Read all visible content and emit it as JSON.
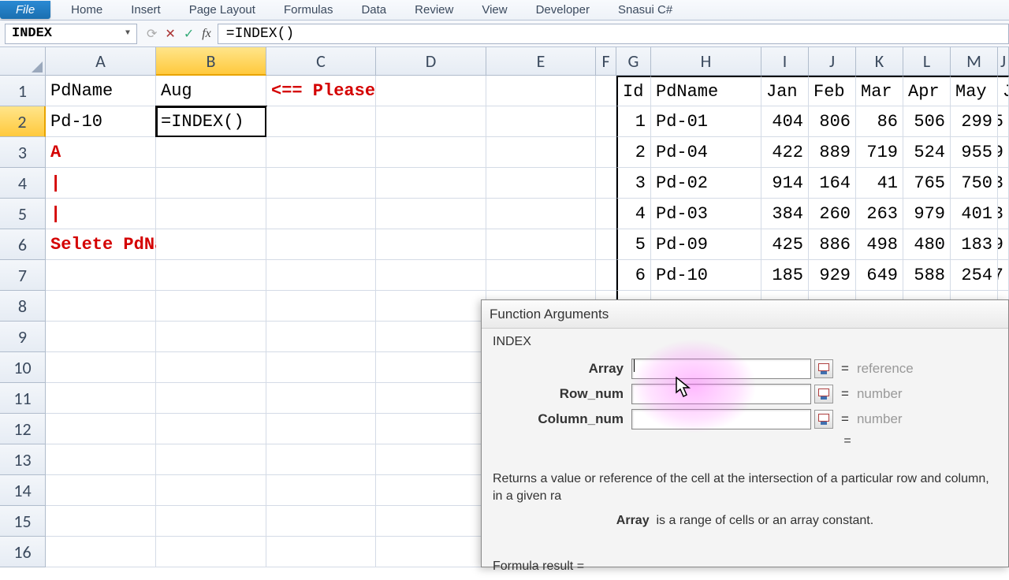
{
  "ribbon": {
    "file": "File",
    "tabs": [
      "Home",
      "Insert",
      "Page Layout",
      "Formulas",
      "Data",
      "Review",
      "View",
      "Developer",
      "Snasui C#"
    ]
  },
  "namebox": "INDEX",
  "formula": "=INDEX()",
  "columns": [
    "A",
    "B",
    "C",
    "D",
    "E",
    "F",
    "G",
    "H",
    "I",
    "J",
    "K",
    "L",
    "M",
    "J"
  ],
  "rows": [
    "1",
    "2",
    "3",
    "4",
    "5",
    "6",
    "7",
    "8",
    "9",
    "10",
    "11",
    "12",
    "13",
    "14",
    "15",
    "16"
  ],
  "grid": {
    "r1": {
      "A": "PdName",
      "B": "Aug",
      "CDE": "<== Please select month",
      "G": "Id",
      "H": "PdName",
      "I": "Jan",
      "J": "Feb",
      "K": "Mar",
      "L": "Apr",
      "M": "May",
      "N": "J"
    },
    "r2": {
      "A": "Pd-10",
      "B": "=INDEX()",
      "G": "1",
      "H": "Pd-01",
      "I": "404",
      "J": "806",
      "K": "86",
      "L": "506",
      "M": "299",
      "N": "5"
    },
    "r3": {
      "A": "A",
      "G": "2",
      "H": "Pd-04",
      "I": "422",
      "J": "889",
      "K": "719",
      "L": "524",
      "M": "955",
      "N": "9"
    },
    "r4": {
      "A": "|",
      "G": "3",
      "H": "Pd-02",
      "I": "914",
      "J": "164",
      "K": "41",
      "L": "765",
      "M": "750",
      "N": "3"
    },
    "r5": {
      "A": "|",
      "G": "4",
      "H": "Pd-03",
      "I": "384",
      "J": "260",
      "K": "263",
      "L": "979",
      "M": "401",
      "N": "3"
    },
    "r6": {
      "A": "Selete PdName",
      "G": "5",
      "H": "Pd-09",
      "I": "425",
      "J": "886",
      "K": "498",
      "L": "480",
      "M": "183",
      "N": "9"
    },
    "r7": {
      "G": "6",
      "H": "Pd-10",
      "I": "185",
      "J": "929",
      "K": "649",
      "L": "588",
      "M": "254",
      "N": "7"
    }
  },
  "dialog": {
    "title": "Function Arguments",
    "fn": "INDEX",
    "args": [
      {
        "label": "Array",
        "hint": "reference"
      },
      {
        "label": "Row_num",
        "hint": "number"
      },
      {
        "label": "Column_num",
        "hint": "number"
      }
    ],
    "eq": "=",
    "desc": "Returns a value or reference of the cell at the intersection of a particular row and column, in a given ra",
    "arg_name": "Array",
    "arg_desc": "is a range of cells or an array constant.",
    "result": "Formula result ="
  }
}
